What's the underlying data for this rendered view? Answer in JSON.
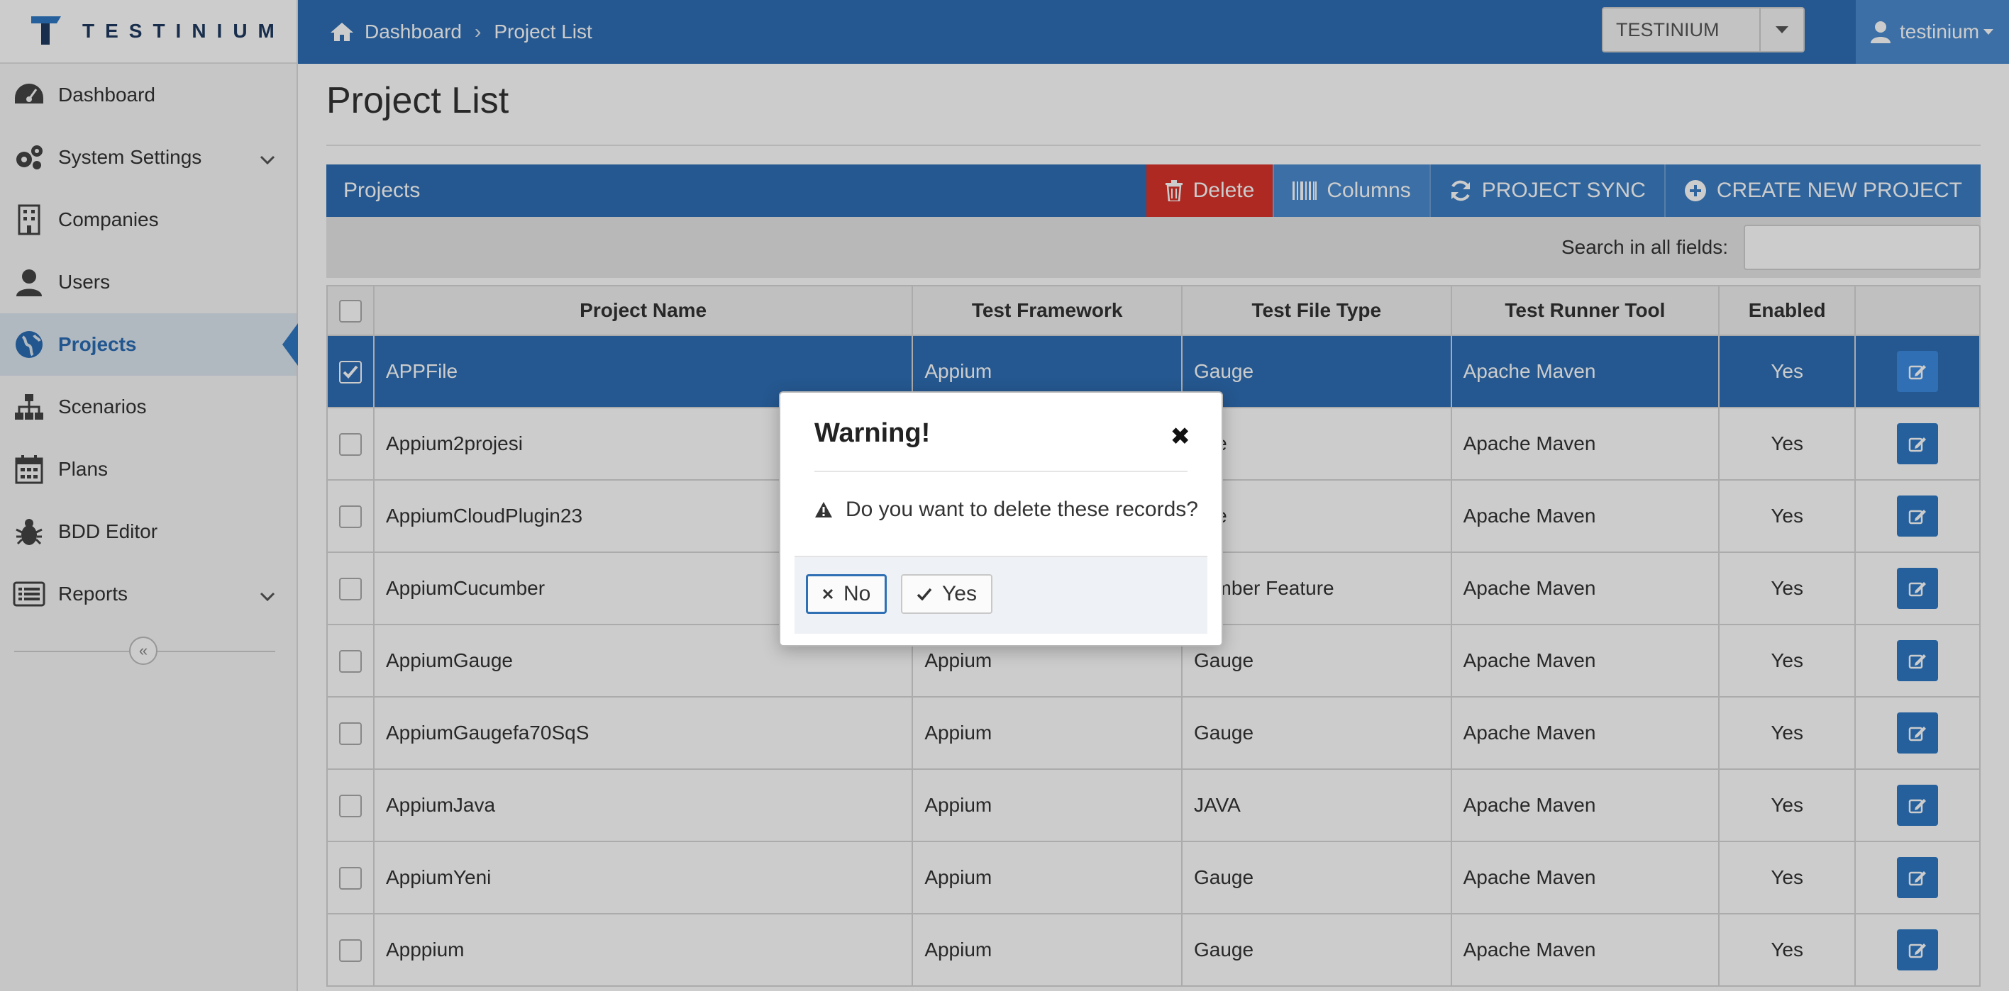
{
  "app": {
    "logo_text": "TESTINIUM"
  },
  "sidebar": {
    "items": [
      {
        "label": "Dashboard",
        "icon": "dashboard-icon"
      },
      {
        "label": "System Settings",
        "icon": "gears-icon",
        "has_submenu": true
      },
      {
        "label": "Companies",
        "icon": "building-icon"
      },
      {
        "label": "Users",
        "icon": "user-icon"
      },
      {
        "label": "Projects",
        "icon": "globe-icon",
        "active": true
      },
      {
        "label": "Scenarios",
        "icon": "sitemap-icon"
      },
      {
        "label": "Plans",
        "icon": "calendar-icon"
      },
      {
        "label": "BDD Editor",
        "icon": "bug-icon"
      },
      {
        "label": "Reports",
        "icon": "list-icon",
        "has_submenu": true
      }
    ]
  },
  "header": {
    "breadcrumb": [
      "Dashboard",
      "Project List"
    ],
    "tenant_select": "TESTINIUM",
    "user": "testinium"
  },
  "page": {
    "title": "Project List"
  },
  "panel": {
    "title": "Projects",
    "buttons": {
      "delete": "Delete",
      "columns": "Columns",
      "sync": "PROJECT SYNC",
      "create": "CREATE NEW PROJECT"
    },
    "search_label": "Search in all fields:",
    "search_value": ""
  },
  "table": {
    "columns": [
      "Project Name",
      "Test Framework",
      "Test File Type",
      "Test Runner Tool",
      "Enabled"
    ],
    "rows": [
      {
        "name": "APPFile",
        "framework": "Appium",
        "file_type": "Gauge",
        "runner": "Apache Maven",
        "enabled": "Yes",
        "checked": true
      },
      {
        "name": "Appium2projesi",
        "framework": "",
        "file_type": "uge",
        "runner": "Apache Maven",
        "enabled": "Yes",
        "checked": false
      },
      {
        "name": "AppiumCloudPlugin23",
        "framework": "",
        "file_type": "uge",
        "runner": "Apache Maven",
        "enabled": "Yes",
        "checked": false
      },
      {
        "name": "AppiumCucumber",
        "framework": "",
        "file_type": "cumber Feature",
        "runner": "Apache Maven",
        "enabled": "Yes",
        "checked": false
      },
      {
        "name": "AppiumGauge",
        "framework": "Appium",
        "file_type": "Gauge",
        "runner": "Apache Maven",
        "enabled": "Yes",
        "checked": false
      },
      {
        "name": "AppiumGaugefa70SqS",
        "framework": "Appium",
        "file_type": "Gauge",
        "runner": "Apache Maven",
        "enabled": "Yes",
        "checked": false
      },
      {
        "name": "AppiumJava",
        "framework": "Appium",
        "file_type": "JAVA",
        "runner": "Apache Maven",
        "enabled": "Yes",
        "checked": false
      },
      {
        "name": "AppiumYeni",
        "framework": "Appium",
        "file_type": "Gauge",
        "runner": "Apache Maven",
        "enabled": "Yes",
        "checked": false
      },
      {
        "name": "Apppium",
        "framework": "Appium",
        "file_type": "Gauge",
        "runner": "Apache Maven",
        "enabled": "Yes",
        "checked": false
      }
    ]
  },
  "modal": {
    "title": "Warning!",
    "message": "Do you want to delete these records?",
    "no_label": "No",
    "yes_label": "Yes"
  },
  "colors": {
    "primary": "#2f6fb4",
    "danger": "#d9342b",
    "accent": "#4a8bd0"
  }
}
